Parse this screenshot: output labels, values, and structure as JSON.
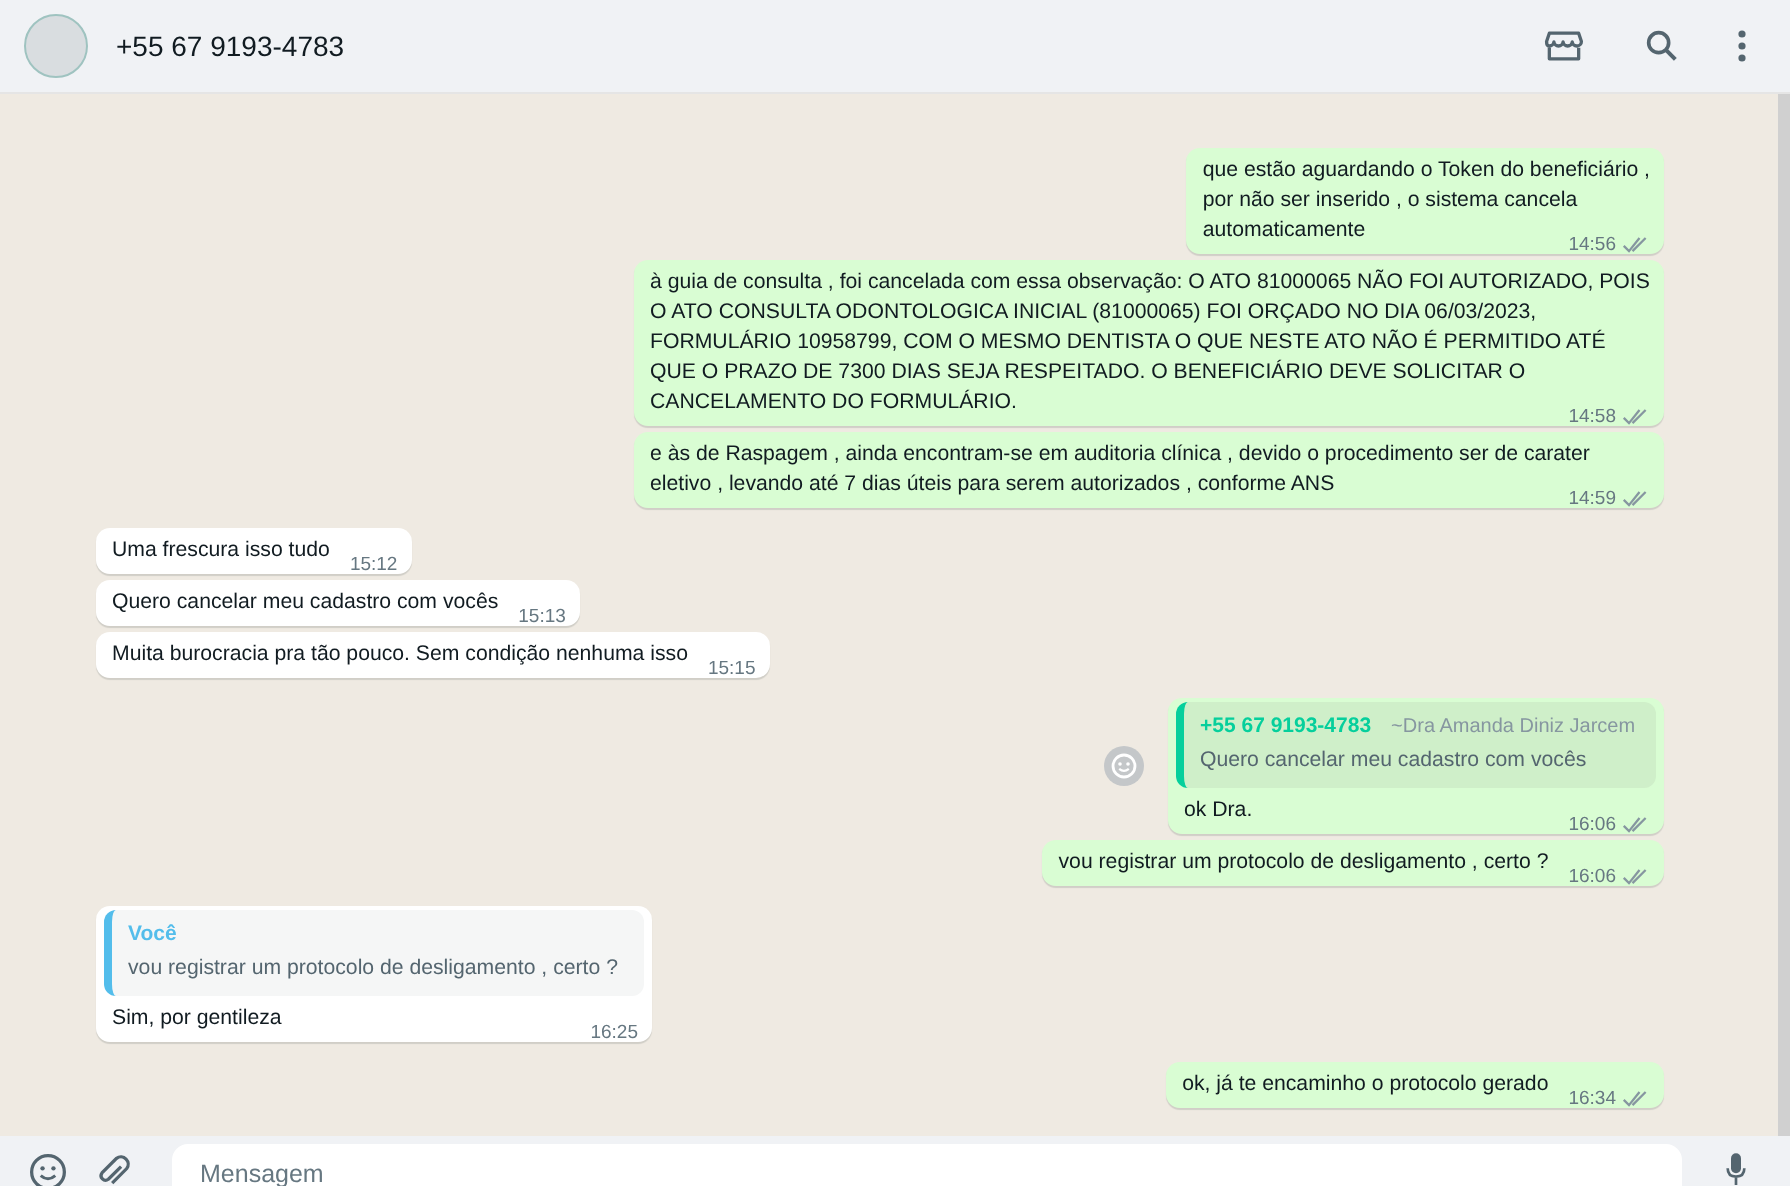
{
  "header": {
    "contact": "+55 67 9193-4783"
  },
  "messages": [
    {
      "outgoing": true,
      "text": "que estão aguardando o Token do beneficiário ,\npor não ser inserido , o sistema cancela\nautomaticamente",
      "time": "14:56",
      "read": false
    },
    {
      "outgoing": true,
      "text": "à guia de consulta , foi cancelada com essa observação: O ATO 81000065 NÃO FOI AUTORIZADO, POIS O ATO CONSULTA ODONTOLOGICA INICIAL (81000065) FOI ORÇADO NO DIA 06/03/2023, FORMULÁRIO 10958799, COM O MESMO DENTISTA O QUE NESTE ATO NÃO É PERMITIDO ATÉ QUE O PRAZO DE 7300 DIAS SEJA RESPEITADO. O BENEFICIÁRIO DEVE SOLICITAR O CANCELAMENTO DO FORMULÁRIO.",
      "time": "14:58",
      "read": false
    },
    {
      "outgoing": true,
      "text": "e às de Raspagem , ainda encontram-se em auditoria clínica , devido o procedimento ser de carater eletivo , levando até 7 dias úteis para serem autorizados , conforme ANS",
      "time": "14:59",
      "read": false
    },
    {
      "outgoing": false,
      "text": "Uma frescura isso tudo",
      "time": "15:12"
    },
    {
      "outgoing": false,
      "text": "Quero cancelar meu cadastro com vocês",
      "time": "15:13"
    },
    {
      "outgoing": false,
      "text": "Muita burocracia pra tão pouco. Sem condição nenhuma isso",
      "time": "15:15"
    },
    {
      "outgoing": true,
      "text": "ok Dra.",
      "time": "16:06",
      "read": false,
      "reaction_button": true,
      "quote": {
        "author": "+55 67 9193-4783",
        "subtitle": "~Dra Amanda Diniz Jarcem",
        "text": "Quero cancelar meu cadastro com vocês"
      }
    },
    {
      "outgoing": true,
      "text": "vou registrar um protocolo de desligamento , certo ?",
      "time": "16:06",
      "read": false
    },
    {
      "outgoing": false,
      "text": "Sim, por gentileza",
      "time": "16:25",
      "quote": {
        "author": "Você",
        "text": "vou registrar um protocolo de desligamento , certo ?"
      }
    },
    {
      "outgoing": true,
      "text": "ok, já te encaminho o protocolo gerado",
      "time": "16:34",
      "read": false
    }
  ],
  "composer": {
    "placeholder": "Mensagem"
  }
}
